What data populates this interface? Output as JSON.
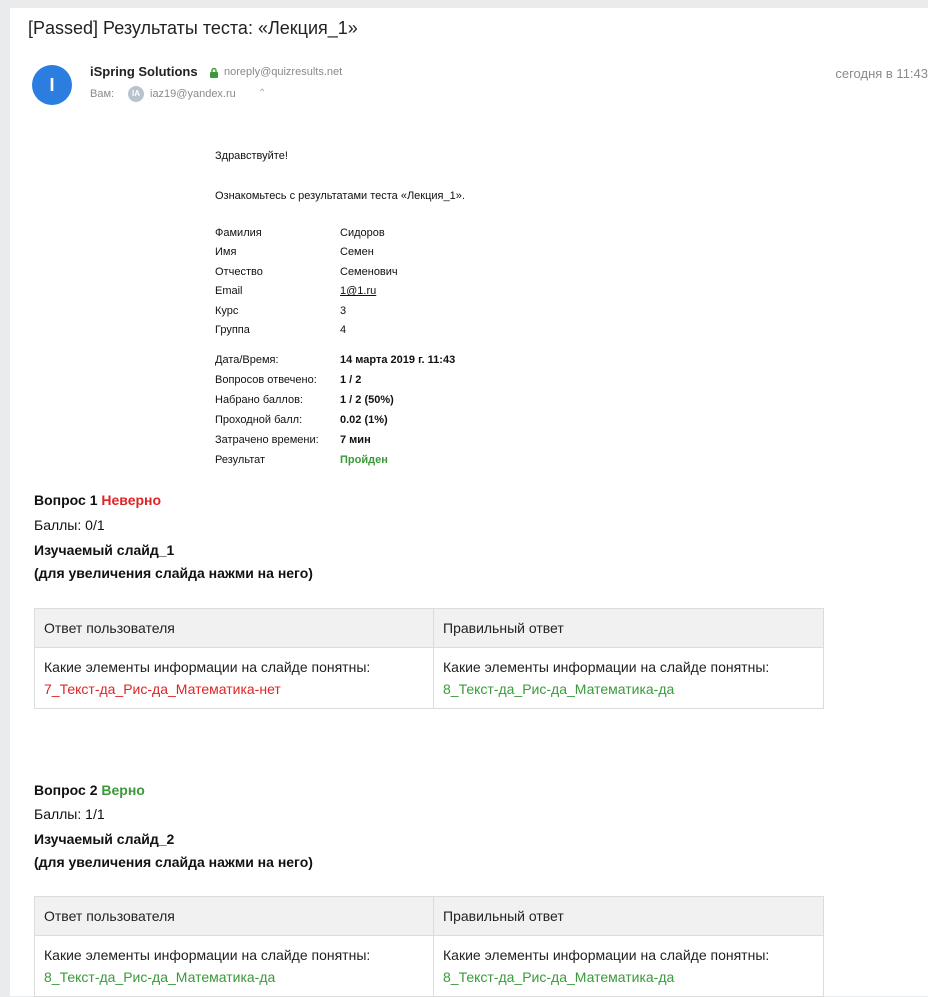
{
  "email": {
    "subject": "[Passed] Результаты теста: «Лекция_1»",
    "avatar_letter": "I",
    "sender_name": "iSpring Solutions",
    "sender_email": "noreply@quizresults.net",
    "to_label": "Вам:",
    "to_avatar": "IA",
    "to_email": "iaz19@yandex.ru",
    "date": "сегодня в 11:43"
  },
  "body": {
    "greeting": "Здравствуйте!",
    "intro": "Ознакомьтесь с результатами теста «Лекция_1».",
    "info": [
      {
        "key": "Фамилия",
        "value": "Сидоров"
      },
      {
        "key": "Имя",
        "value": "Семен"
      },
      {
        "key": "Отчество",
        "value": "Семенович"
      },
      {
        "key": "Email",
        "value": "1@1.ru"
      },
      {
        "key": "Курс",
        "value": "3"
      },
      {
        "key": "Группа",
        "value": "4"
      }
    ],
    "results": [
      {
        "key": "Дата/Время:",
        "value": "14 марта 2019 г. 11:43"
      },
      {
        "key": "Вопросов отвечено:",
        "value": "1 / 2"
      },
      {
        "key": "Набрано баллов:",
        "value": "1 / 2 (50%)"
      },
      {
        "key": "Проходной балл:",
        "value": "0.02 (1%)"
      },
      {
        "key": "Затрачено времени:",
        "value": "7 мин"
      },
      {
        "key": "Результат",
        "value": "Пройден"
      }
    ]
  },
  "questions": [
    {
      "title": "Вопрос 1",
      "status": "Неверно",
      "score": "Баллы: 0/1",
      "slide": "Изучаемый слайд_1",
      "hint": "(для увеличения слайда нажми на него)",
      "col_user": "Ответ пользователя",
      "col_correct": "Правильный ответ",
      "user_text": "Какие элементы информации на слайде понятны:",
      "user_answer": "7_Текст-да_Рис-да_Математика-нет",
      "correct_text": "Какие элементы информации на слайде понятны:",
      "correct_answer": "8_Текст-да_Рис-да_Математика-да"
    },
    {
      "title": "Вопрос 2",
      "status": "Верно",
      "score": "Баллы: 1/1",
      "slide": "Изучаемый слайд_2",
      "hint": "(для увеличения слайда нажми на него)",
      "col_user": "Ответ пользователя",
      "col_correct": "Правильный ответ",
      "user_text": "Какие элементы информации на слайде понятны:",
      "user_answer": "8_Текст-да_Рис-да_Математика-да",
      "correct_text": "Какие элементы информации на слайде понятны:",
      "correct_answer": "8_Текст-да_Рис-да_Математика-да"
    }
  ],
  "colors": {
    "wrong": "#e02424",
    "right": "#3a9a3a",
    "avatar": "#2b7de0"
  }
}
